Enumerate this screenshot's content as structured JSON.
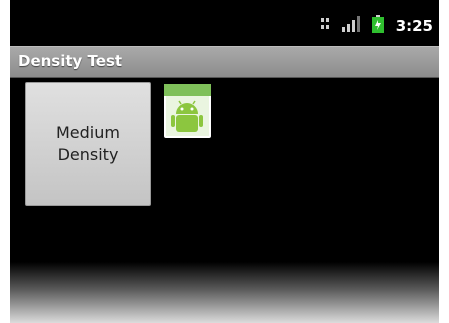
{
  "status_bar": {
    "time": "3:25",
    "icons": [
      "data-icon",
      "signal-icon",
      "battery-icon"
    ]
  },
  "app": {
    "title": "Density Test"
  },
  "content": {
    "density_button_label": "Medium\nDensity",
    "image_icon": "android-icon"
  },
  "colors": {
    "screen_bg": "#000000",
    "title_bar": "#9a9a9a",
    "button_bg": "#d6d6d6",
    "battery": "#2fbf2f",
    "android_green": "#8cc63f"
  }
}
